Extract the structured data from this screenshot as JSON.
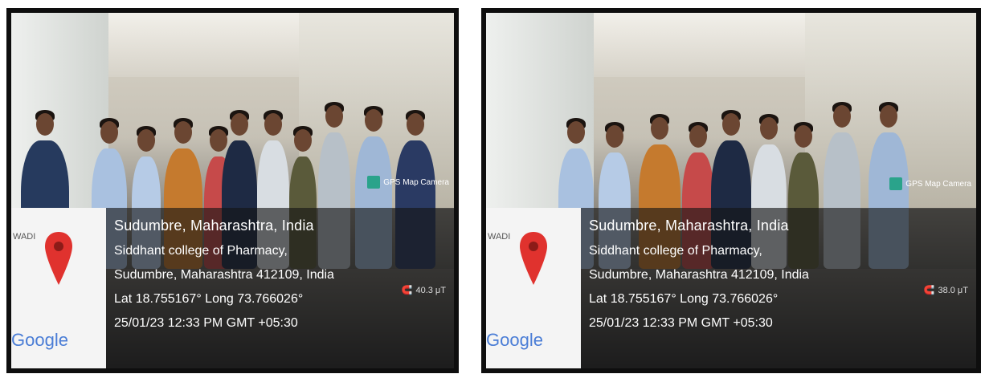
{
  "photos": [
    {
      "badge": "GPS Map Camera",
      "map_place_fragment": "WADI",
      "map_logo": "Google",
      "address_line1": "Sudumbre, Maharashtra, India",
      "address_line2": "Siddhant college of Pharmacy,",
      "address_line3": "Sudumbre, Maharashtra 412109, India",
      "coords": "Lat 18.755167° Long 73.766026°",
      "timestamp": "25/01/23 12:33 PM GMT +05:30",
      "magnetic": "40.3 μT",
      "icons": [
        "gps-map-camera-icon",
        "location-pin-icon",
        "magnet-icon"
      ]
    },
    {
      "badge": "GPS Map Camera",
      "map_place_fragment": "WADI",
      "map_logo": "Google",
      "address_line1": "Sudumbre, Maharashtra, India",
      "address_line2": "Siddhant college of Pharmacy,",
      "address_line3": "Sudumbre, Maharashtra 412109, India",
      "coords": "Lat 18.755167° Long 73.766026°",
      "timestamp": "25/01/23 12:33 PM GMT +05:30",
      "magnetic": "38.0 μT",
      "icons": [
        "gps-map-camera-icon",
        "location-pin-icon",
        "magnet-icon"
      ]
    }
  ],
  "colors": {
    "frame": "#0e0e0e",
    "overlay": "#141414",
    "pin": "#e0322e",
    "badge_icon": "#2aa38b"
  }
}
